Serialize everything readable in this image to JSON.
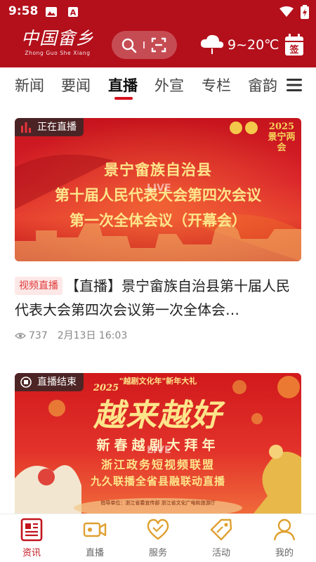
{
  "status": {
    "time": "9:58"
  },
  "header": {
    "logo_cn": "中国畲乡",
    "logo_en": "Zhong Guo She Xiang",
    "weather": "9~20℃",
    "signin_label": "签"
  },
  "tabs": [
    {
      "label": "新闻"
    },
    {
      "label": "要闻"
    },
    {
      "label": "直播"
    },
    {
      "label": "外宣"
    },
    {
      "label": "专栏"
    },
    {
      "label": "畲韵"
    }
  ],
  "feed": [
    {
      "status": "正在直播",
      "poster_lines": [
        "景宁畲族自治县",
        "第十届人民代表大会第四次会议",
        "第一次全体会议（开幕会）"
      ],
      "poster_corner": "2025 景宁两会",
      "live_watermark": "LIVE",
      "tag": "视频直播",
      "title": "【直播】景宁畲族自治县第十届人民代表大会第四次会议第一次全体会…",
      "views": "737",
      "date": "2月13日 16:03"
    },
    {
      "status": "直播结束",
      "poster_top": "\"越剧文化年\"新年大礼",
      "poster_year": "2025",
      "poster_big": "越来越好",
      "poster_sub": "新春越剧大拜年",
      "poster_line3": "浙江政务短视频联盟",
      "poster_line4": "九久联播全省县融联动直播",
      "poster_foot": "指导单位：浙江省委宣传部 浙江省文化广电和旅游厅",
      "live_watermark": "LIVE"
    }
  ],
  "bottom_nav": [
    {
      "label": "资讯",
      "icon": "news-icon",
      "active": true
    },
    {
      "label": "直播",
      "icon": "video-camera-icon",
      "active": false
    },
    {
      "label": "服务",
      "icon": "heart-icon",
      "active": false
    },
    {
      "label": "活动",
      "icon": "tag-icon",
      "active": false
    },
    {
      "label": "我的",
      "icon": "person-icon",
      "active": false
    }
  ],
  "colors": {
    "brand_red": "#b3101b",
    "accent_red": "#d6101e",
    "nav_active": "#c2141d",
    "tag_bg": "#fde8e8"
  }
}
